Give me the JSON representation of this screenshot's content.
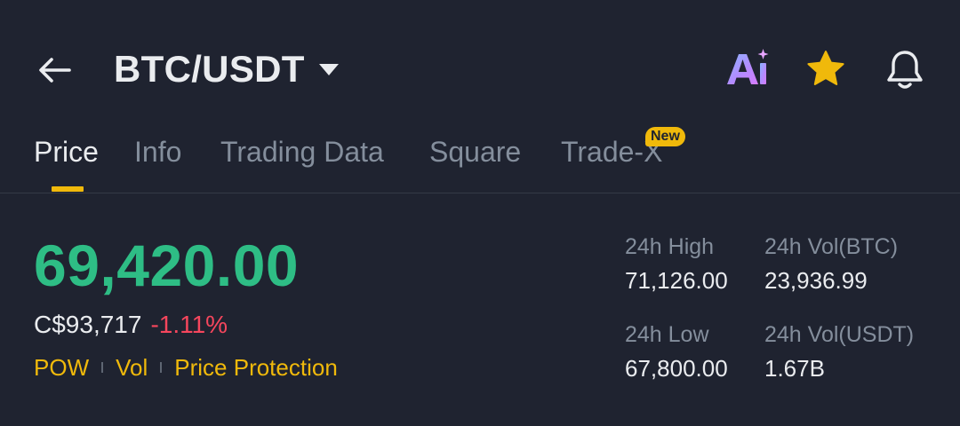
{
  "header": {
    "pair": "BTC/USDT",
    "icons": {
      "back": "back-arrow-icon",
      "caret": "caret-down-icon",
      "ai": "ai-icon",
      "favorite": "star-icon",
      "alert": "bell-icon"
    }
  },
  "tabs": [
    {
      "label": "Price",
      "active": true
    },
    {
      "label": "Info"
    },
    {
      "label": "Trading Data"
    },
    {
      "label": "Square"
    },
    {
      "label": "Trade-X",
      "badge": "New"
    }
  ],
  "price": {
    "last": "69,420.00",
    "fiat": "C$93,717",
    "change": "-1.11%",
    "tags": [
      "POW",
      "Vol",
      "Price Protection"
    ]
  },
  "stats": {
    "high_label": "24h High",
    "high_value": "71,126.00",
    "low_label": "24h Low",
    "low_value": "67,800.00",
    "vol_btc_label": "24h Vol(BTC)",
    "vol_btc_value": "23,936.99",
    "vol_usdt_label": "24h Vol(USDT)",
    "vol_usdt_value": "1.67B"
  },
  "colors": {
    "background": "#1f2330",
    "up": "#2ebd85",
    "down": "#f6465d",
    "accent": "#f0b90b",
    "muted": "#848e9c",
    "text": "#eaecef"
  }
}
